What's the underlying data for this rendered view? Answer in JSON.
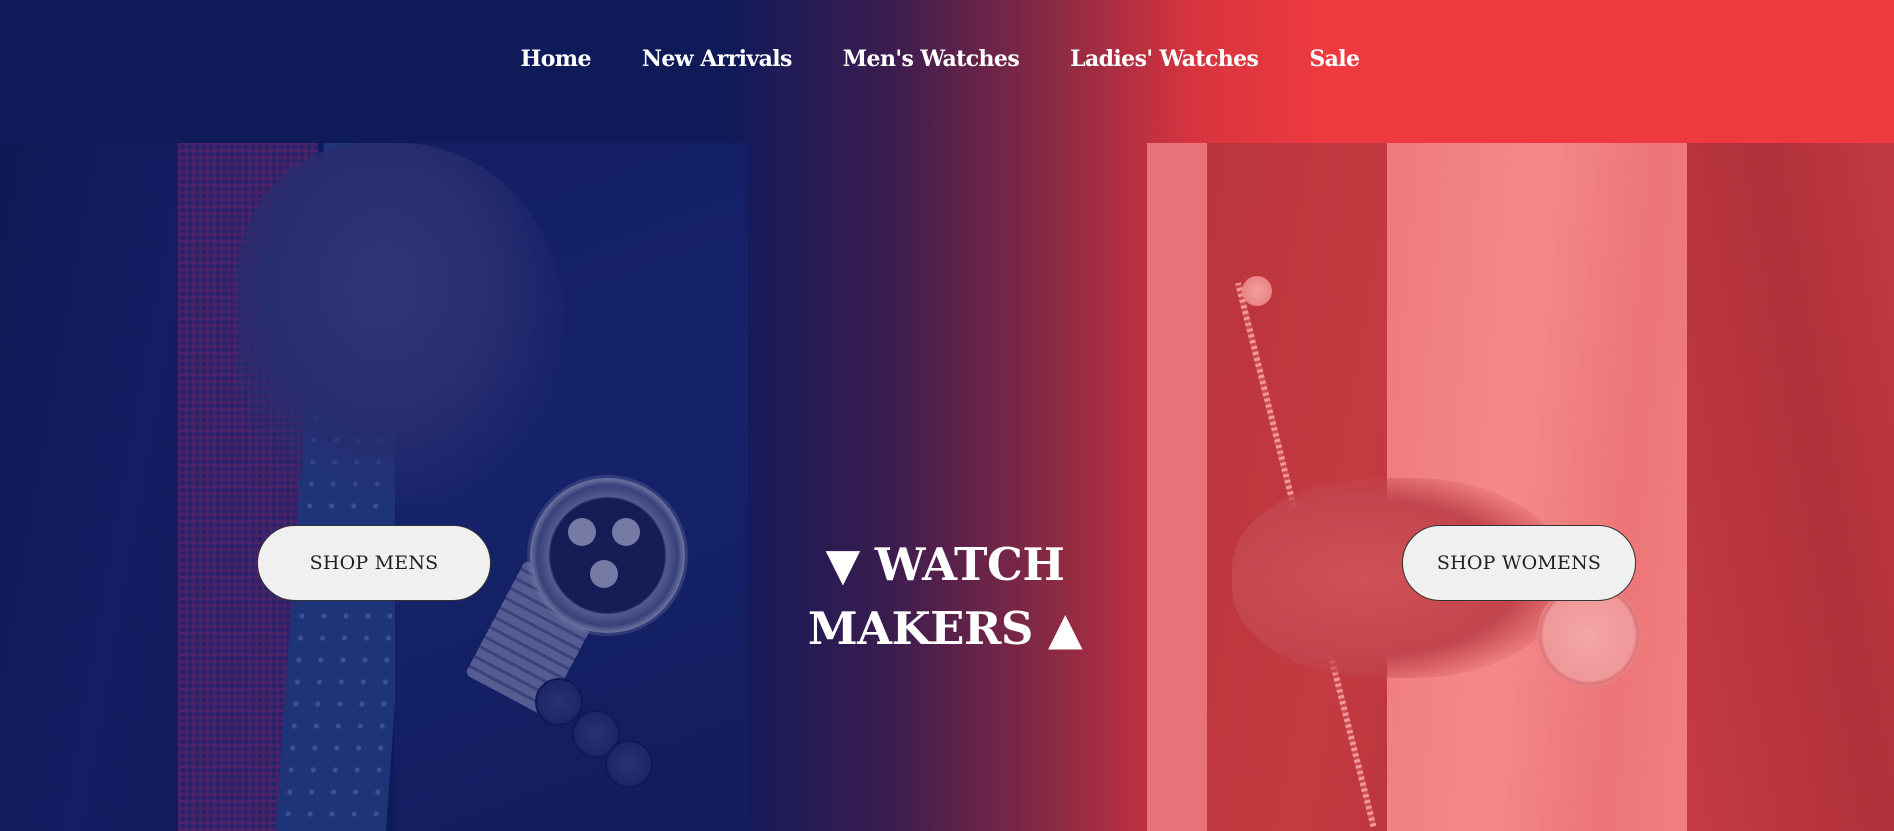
{
  "nav": {
    "items": [
      {
        "label": "Home"
      },
      {
        "label": "New Arrivals"
      },
      {
        "label": "Men's Watches"
      },
      {
        "label": "Ladies' Watches"
      },
      {
        "label": "Sale"
      }
    ]
  },
  "hero": {
    "headline_line1": "▼ WATCH",
    "headline_line2": "MAKERS ▲",
    "shop_mens_label": "SHOP MENS",
    "shop_womens_label": "SHOP WOMENS"
  },
  "colors": {
    "navy": "#0f1a59",
    "red": "#ee3a3f",
    "button_bg": "#f0f0f0",
    "text_white": "#ffffff"
  }
}
